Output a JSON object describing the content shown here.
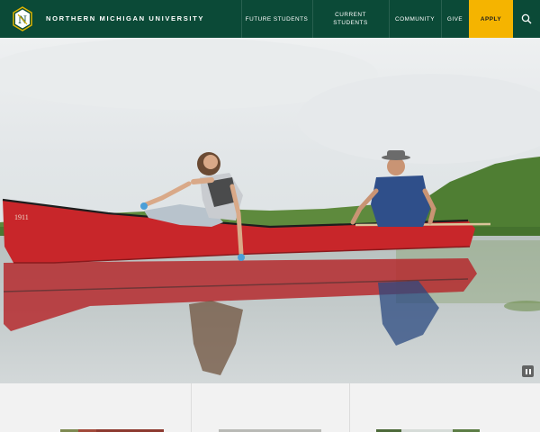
{
  "header": {
    "logo_letter": "N",
    "university_name": "NORTHERN MICHIGAN UNIVERSITY",
    "nav": {
      "future_students": "FUTURE STUDENTS",
      "current_students_line1": "CURRENT",
      "current_students_line2": "STUDENTS",
      "community": "COMMUNITY",
      "give": "GIVE",
      "apply": "APPLY"
    },
    "icons": {
      "search": "search-icon",
      "logo": "nmu-logo-icon"
    }
  },
  "hero": {
    "media": "video-hero",
    "controls": {
      "pause": "pause-icon"
    },
    "canoe_marking": "1911"
  },
  "colors": {
    "brand_green": "#0b4a37",
    "apply_gold": "#f5b400",
    "canoe_red": "#c8262a",
    "water": "#b9c4c4"
  }
}
